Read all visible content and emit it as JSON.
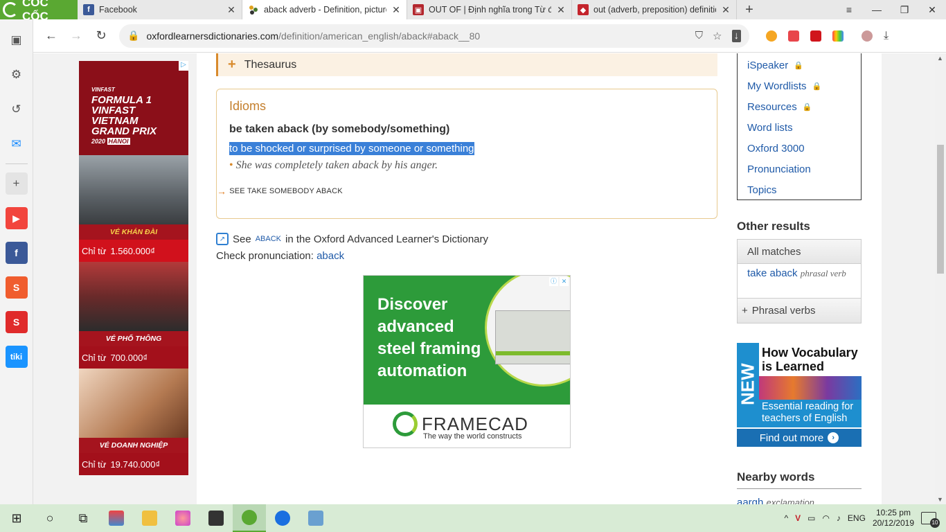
{
  "browser": {
    "brand": "CỐC CỐC",
    "tabs": [
      {
        "title": "Facebook",
        "icon": "facebook-icon",
        "color": "#3b5998",
        "active": false
      },
      {
        "title": "aback adverb - Definition, pictures",
        "icon": "oxford-icon",
        "color": "#ffffff",
        "active": true
      },
      {
        "title": "OUT OF | Định nghĩa trong Từ điển",
        "icon": "cambridge-icon",
        "color": "#b3262d",
        "active": false
      },
      {
        "title": "out (adverb, preposition) definition",
        "icon": "macmillan-icon",
        "color": "#c4242c",
        "active": false
      }
    ],
    "url_host": "oxfordlearnersdictionaries.com",
    "url_path": "/definition/american_english/aback#aback__80"
  },
  "sidebar_apps": [
    {
      "name": "youtube",
      "color": "#f2453d"
    },
    {
      "name": "facebook",
      "color": "#3b5998"
    },
    {
      "name": "shopee",
      "color": "#f05d2e"
    },
    {
      "name": "sendo",
      "color": "#e02b2b"
    },
    {
      "name": "tiki",
      "color": "#1a94ff"
    }
  ],
  "left_ad": {
    "logo_line1": "FORMULA 1",
    "logo_line2": "VINFAST",
    "logo_line3": "VIETNAM",
    "logo_line4": "GRAND PRIX",
    "logo_year": "2020",
    "logo_city": "HANOI",
    "blocks": [
      {
        "band": "VÉ KHÁN ĐÀI",
        "prefix": "Chỉ từ",
        "price": "1.560.000₫"
      },
      {
        "band": "VÉ PHỔ THÔNG",
        "prefix": "Chỉ từ",
        "price": "700.000₫"
      },
      {
        "band": "VÉ DOANH NGHIỆP",
        "prefix": "Chỉ từ",
        "price": "19.740.000₫"
      }
    ]
  },
  "main": {
    "thesaurus": "Thesaurus",
    "idioms_head": "Idioms",
    "idiom_phrase": "be taken aback (by somebody/something)",
    "idiom_def": "to be shocked or surprised by someone or something",
    "idiom_example": "She was completely taken aback by his anger.",
    "see_link": "see take somebody aback",
    "see_pre": "See",
    "see_word": "aback",
    "see_post": "in the Oxford Advanced Learner's Dictionary",
    "check_pron_label": "Check pronunciation:",
    "check_pron_link": "aback"
  },
  "framecad_ad": {
    "line1": "Discover",
    "line2": "advanced",
    "line3": "steel framing",
    "line4": "automation",
    "brand": "FRAMECAD",
    "tagline": "The way the world constructs"
  },
  "right": {
    "menu": [
      {
        "label": "iSpeaker",
        "locked": true
      },
      {
        "label": "My Wordlists",
        "locked": true
      },
      {
        "label": "Resources",
        "locked": true
      },
      {
        "label": "Word lists",
        "locked": false
      },
      {
        "label": "Oxford 3000",
        "locked": false
      },
      {
        "label": "Pronunciation",
        "locked": false
      },
      {
        "label": "Topics",
        "locked": false
      }
    ],
    "other_results": "Other results",
    "all_matches": "All matches",
    "result_word": "take aback",
    "result_pos": "phrasal verb",
    "phrasal_verbs": "Phrasal verbs",
    "vocab_ad": {
      "new": "NEW",
      "title": "How Vocabulary is Learned",
      "essential": "Essential reading for teachers of English",
      "findout": "Find out more"
    },
    "nearby_words": "Nearby words",
    "nearby_item": "aargh",
    "nearby_item_pos": "exclamation"
  },
  "taskbar": {
    "lang": "ENG",
    "time": "10:25 pm",
    "date": "20/12/2019",
    "notifications": "10"
  }
}
